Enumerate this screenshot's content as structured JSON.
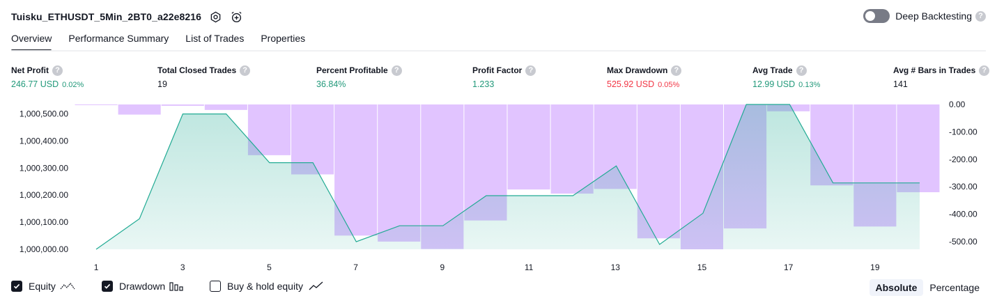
{
  "header": {
    "title": "Tuisku_ETHUSDT_5Min_2BT0_a22e8216",
    "deep_backtesting_label": "Deep Backtesting",
    "help_glyph": "?"
  },
  "tabs": [
    {
      "label": "Overview",
      "active": true
    },
    {
      "label": "Performance Summary",
      "active": false
    },
    {
      "label": "List of Trades",
      "active": false
    },
    {
      "label": "Properties",
      "active": false
    }
  ],
  "metrics": {
    "net_profit": {
      "label": "Net Profit",
      "value": "246.77 USD",
      "pct": "0.02%"
    },
    "closed_trades": {
      "label": "Total Closed Trades",
      "value": "19"
    },
    "percent_profitable": {
      "label": "Percent Profitable",
      "value": "36.84%"
    },
    "profit_factor": {
      "label": "Profit Factor",
      "value": "1.233"
    },
    "max_drawdown": {
      "label": "Max Drawdown",
      "value": "525.92 USD",
      "pct": "0.05%"
    },
    "avg_trade": {
      "label": "Avg Trade",
      "value": "12.99 USD",
      "pct": "0.13%"
    },
    "avg_bars": {
      "label": "Avg # Bars in Trades",
      "value": "141"
    }
  },
  "legend": {
    "equity": {
      "label": "Equity",
      "checked": true
    },
    "drawdown": {
      "label": "Drawdown",
      "checked": true
    },
    "buy_hold": {
      "label": "Buy & hold equity",
      "checked": false
    }
  },
  "mode": {
    "absolute": "Absolute",
    "percentage": "Percentage",
    "selected": "absolute"
  },
  "colors": {
    "equity_line": "#22ab94",
    "drawdown_bar": "#e1c4ff",
    "positive": "#22997a",
    "negative": "#f23645"
  },
  "chart_data": {
    "type": "area",
    "x": [
      1,
      2,
      3,
      4,
      5,
      6,
      7,
      8,
      9,
      10,
      11,
      12,
      13,
      14,
      15,
      16,
      17,
      18,
      19,
      20
    ],
    "x_ticks": [
      "1",
      "3",
      "5",
      "7",
      "9",
      "11",
      "13",
      "15",
      "17",
      "19"
    ],
    "left_ticks": [
      "1,000,500.00",
      "1,000,400.00",
      "1,000,300.00",
      "1,000,200.00",
      "1,000,100.00",
      "1,000,000.00"
    ],
    "right_ticks": [
      "0.00",
      "-100.00",
      "-200.00",
      "-300.00",
      "-400.00",
      "-500.00"
    ],
    "left_ylim": [
      1000000,
      1000535
    ],
    "right_ylim": [
      -528,
      0
    ],
    "series": [
      {
        "name": "Equity",
        "axis": "left",
        "values": [
          1000000,
          1000113,
          1000500,
          1000500,
          1000320,
          1000320,
          1000028,
          1000087,
          1000087,
          1000198,
          1000198,
          1000198,
          1000308,
          1000018,
          1000133,
          1000535,
          1000535,
          1000245,
          1000245,
          1000245
        ]
      },
      {
        "name": "Drawdown",
        "axis": "right",
        "values": [
          -2,
          -37,
          -5,
          -20,
          -185,
          -255,
          -478,
          -500,
          -527,
          -423,
          -310,
          -325,
          -308,
          -488,
          -528,
          -452,
          -25,
          -295,
          -445,
          -320
        ]
      }
    ]
  }
}
